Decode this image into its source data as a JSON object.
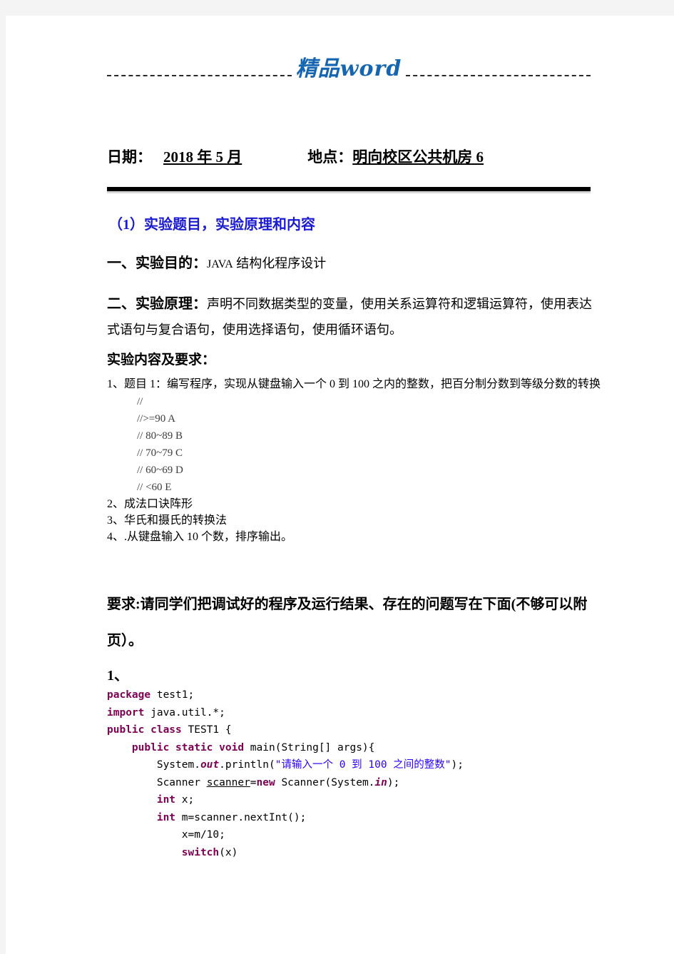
{
  "header": {
    "brand": "精品word"
  },
  "meta": {
    "date_label": "日期：",
    "date_value": "2018 年 5 月",
    "place_label": "地点：",
    "place_value": "明向校区公共机房 6"
  },
  "section": {
    "title_blue": "（1）实验题目，实验原理和内容",
    "purpose_label": "一、实验目的：",
    "purpose_lang": "JAVA",
    "purpose_text": " 结构化程序设计",
    "principle_label": "二、实验原理：",
    "principle_text": "声明不同数据类型的变量，使用关系运算符和逻辑运算符，使用表达式语句与复合语句，使用选择语句，使用循环语句。",
    "contents_head": "实验内容及要求："
  },
  "tasks": [
    {
      "text": "1、题目 1：编写程序，实现从键盘输入一个 0 到 100 之内的整数，把百分制分数到等级分数的转换"
    },
    {
      "text": "2、成法口诀阵形"
    },
    {
      "text": "3、华氏和摄氏的转换法"
    },
    {
      "text": "4、.从键盘输入 10 个数，排序输出。"
    }
  ],
  "task_comments": [
    "//",
    "//>=90 A",
    "// 80~89 B",
    "// 70~79 C",
    "// 60~69 D",
    "// <60 E"
  ],
  "requirement": "要求:请同学们把调试好的程序及运行结果、存在的问题写在下面(不够可以附页）。",
  "answer": {
    "number": "1、"
  },
  "code": {
    "lines": [
      [
        {
          "t": "package ",
          "c": "kw"
        },
        {
          "t": "test1;",
          "c": "pln"
        }
      ],
      [
        {
          "t": "import ",
          "c": "kw"
        },
        {
          "t": "java.util.*;",
          "c": "pln"
        }
      ],
      [
        {
          "t": "public class ",
          "c": "kw"
        },
        {
          "t": "TEST1 {",
          "c": "pln"
        }
      ],
      [
        {
          "t": "    ",
          "c": "pln"
        },
        {
          "t": "public static void ",
          "c": "kw"
        },
        {
          "t": "main(String[] args){",
          "c": "pln"
        }
      ],
      [
        {
          "t": "        System.",
          "c": "pln"
        },
        {
          "t": "out",
          "c": "fld"
        },
        {
          "t": ".println(",
          "c": "pln"
        },
        {
          "t": "\"请输入一个 0 到 100 之间的整数\"",
          "c": "str"
        },
        {
          "t": ");",
          "c": "pln"
        }
      ],
      [
        {
          "t": "        Scanner ",
          "c": "pln"
        },
        {
          "t": "scanner",
          "c": "loc"
        },
        {
          "t": "=",
          "c": "pln"
        },
        {
          "t": "new ",
          "c": "kw"
        },
        {
          "t": "Scanner(System.",
          "c": "pln"
        },
        {
          "t": "in",
          "c": "fld"
        },
        {
          "t": ");",
          "c": "pln"
        }
      ],
      [
        {
          "t": "        ",
          "c": "pln"
        },
        {
          "t": "int ",
          "c": "kw"
        },
        {
          "t": "x;",
          "c": "pln"
        }
      ],
      [
        {
          "t": "        ",
          "c": "pln"
        },
        {
          "t": "int ",
          "c": "kw"
        },
        {
          "t": "m=scanner.nextInt();",
          "c": "pln"
        }
      ],
      [
        {
          "t": "            x=m/10;",
          "c": "pln"
        }
      ],
      [
        {
          "t": "            ",
          "c": "pln"
        },
        {
          "t": "switch",
          "c": "kw"
        },
        {
          "t": "(x)",
          "c": "pln"
        }
      ]
    ]
  },
  "colors": {
    "brand_blue": "#1565b0",
    "heading_blue": "#1a1ad0",
    "code_keyword": "#7f0055",
    "code_string": "#2a00ff"
  }
}
